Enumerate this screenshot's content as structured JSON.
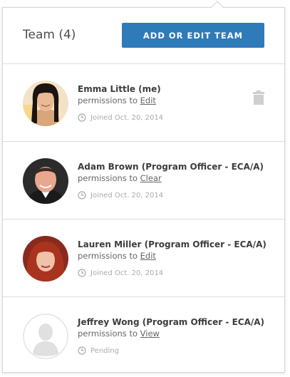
{
  "header": {
    "title": "Team (4)",
    "add_button_label": "ADD OR EDIT TEAM"
  },
  "colors": {
    "accent": "#2f7ab9",
    "muted_text": "#aaaaaa",
    "divider": "#dddddd"
  },
  "members": [
    {
      "name": "Emma Little (me)",
      "permissions_prefix": "permissions to",
      "permission": "Edit",
      "status": "Joined Oct. 20, 2014",
      "status_icon": "clock-icon",
      "can_delete": true,
      "delete_icon": "trash-icon"
    },
    {
      "name": "Adam Brown (Program Officer - ECA/A)",
      "permissions_prefix": "permissions to",
      "permission": "Clear",
      "status": "Joined Oct. 20, 2014",
      "status_icon": "clock-icon"
    },
    {
      "name": "Lauren Miller (Program Officer - ECA/A)",
      "permissions_prefix": "permissions to",
      "permission": "Edit",
      "status": "Joined Oct. 20, 2014",
      "status_icon": "clock-icon"
    },
    {
      "name": "Jeffrey Wong (Program Officer - ECA/A)",
      "permissions_prefix": "permissions to",
      "permission": "View",
      "status": "Pending",
      "status_icon": "clock-icon",
      "avatar": "placeholder-avatar-icon"
    }
  ]
}
